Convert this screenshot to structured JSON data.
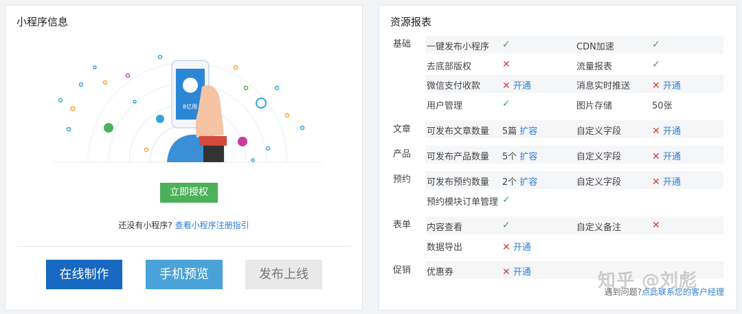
{
  "left_panel": {
    "title": "小程序信息",
    "phone_text": "8亿用",
    "phone_sub": "用户在线",
    "authorize_button": "立即授权",
    "no_app_text": "还没有小程序?",
    "register_link": "查看小程序注册指引",
    "buttons": {
      "online_make": "在线制作",
      "mobile_preview": "手机预览",
      "publish": "发布上线"
    }
  },
  "right_panel": {
    "title": "资源报表",
    "check_mark": "✓",
    "cross_mark": "✕",
    "categories": {
      "basic": "基础",
      "article": "文章",
      "product": "产品",
      "booking": "预约",
      "form": "表单",
      "promotion": "促销"
    },
    "rows": {
      "r1": {
        "a": "一键发布小程序",
        "b": "CDN加速"
      },
      "r2": {
        "a": "去底部版权",
        "b": "流量报表"
      },
      "r3": {
        "a": "微信支付收款",
        "a_link": "开通",
        "b": "消息实时推送",
        "b_link": "开通"
      },
      "r4": {
        "a": "用户管理",
        "b": "图片存储",
        "b_value": "50张"
      },
      "r5": {
        "a": "可发布文章数量",
        "a_value": "5篇",
        "a_link": "扩容",
        "b": "自定义字段",
        "b_link": "开通"
      },
      "r6": {
        "a": "可发布产品数量",
        "a_value": "5个",
        "a_link": "扩容",
        "b": "自定义字段",
        "b_link": "开通"
      },
      "r7": {
        "a": "可发布预约数量",
        "a_value": "2个",
        "a_link": "扩容",
        "b": "自定义字段",
        "b_link": "开通"
      },
      "r8": {
        "a": "预约模块订单管理"
      },
      "r9": {
        "a": "内容查看",
        "b": "自定义备注"
      },
      "r10": {
        "a": "数据导出",
        "a_link": "开通"
      },
      "r11": {
        "a": "优惠券",
        "a_link": "开通"
      }
    },
    "footer_text": "遇到问题?",
    "footer_link": "点此联系您的客户经理"
  },
  "watermark": "知乎 @刘彪",
  "colors": {
    "primary": "#1668c1",
    "green": "#4cb158",
    "check": "#4a9a5a",
    "cross": "#d63b3b",
    "link": "#2f7fd1"
  }
}
